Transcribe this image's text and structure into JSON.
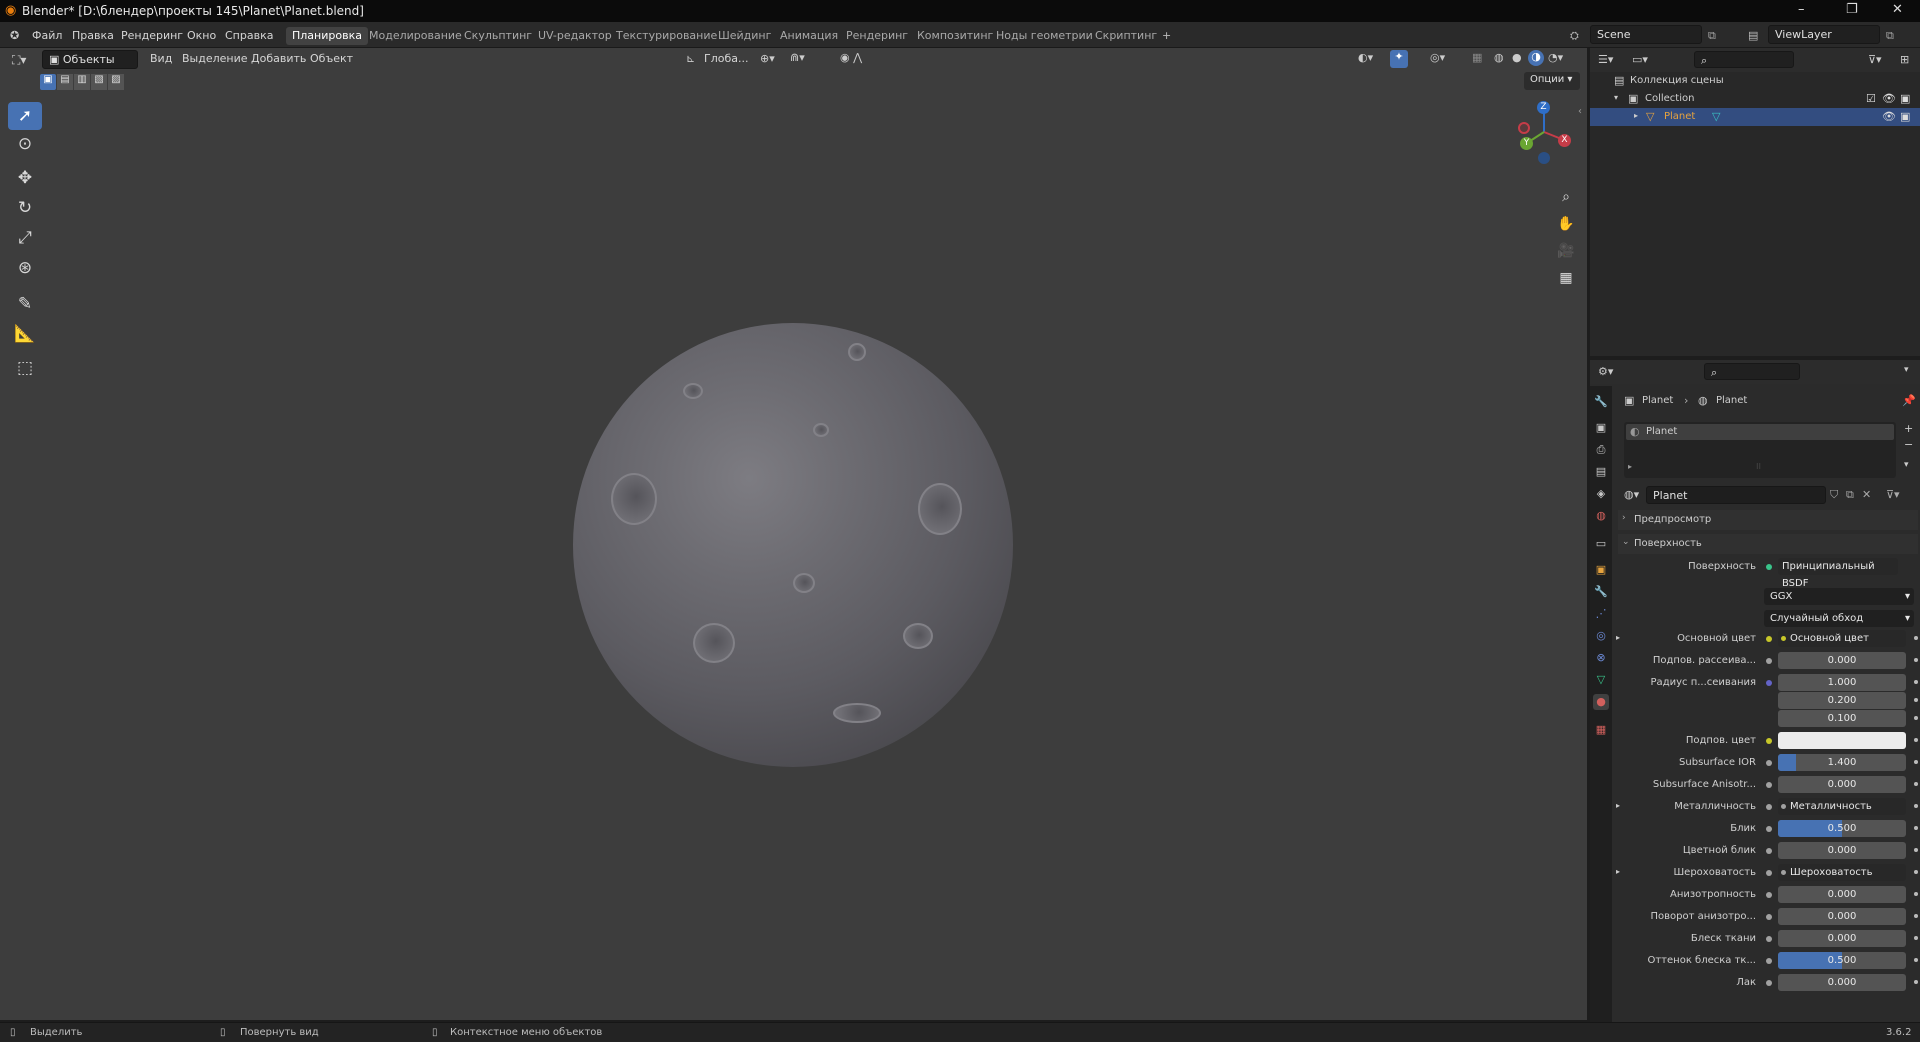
{
  "titlebar": {
    "title": "Blender* [D:\\блендер\\проекты 145\\Planet\\Planet.blend]",
    "minimize": "–",
    "maximize": "❐",
    "close": "✕"
  },
  "menu": {
    "items": [
      "Файл",
      "Правка",
      "Рендеринг",
      "Окно",
      "Справка"
    ]
  },
  "workspaces": {
    "tabs": [
      "Планировка",
      "Моделирование",
      "Скульптинг",
      "UV-редактор",
      "Текстурирование",
      "Шейдинг",
      "Анимация",
      "Рендеринг",
      "Композитинг",
      "Ноды геометрии",
      "Скриптинг"
    ],
    "active": "Планировка",
    "add": "+"
  },
  "scene": {
    "name": "Scene",
    "viewlayer": "ViewLayer"
  },
  "viewport_header": {
    "mode": "Объекты",
    "menus": [
      "Вид",
      "Выделение",
      "Добавить",
      "Объект"
    ],
    "orientation": "Глоба...",
    "options": "Опции"
  },
  "gizmo": {
    "z": "Z",
    "x": "X",
    "y": "Y"
  },
  "outliner": {
    "root": "Коллекция сцены",
    "collection": "Collection",
    "object": "Planet"
  },
  "properties": {
    "breadcrumb": [
      "Planet",
      "Planet"
    ],
    "slot": "Planet",
    "material": "Planet",
    "panel_preview": "Предпросмотр",
    "panel_surface": "Поверхность",
    "surface_label": "Поверхность",
    "surface_value": "Принципиальный BSDF",
    "distribution": "GGX",
    "subsurface_method": "Случайный обход",
    "rows": [
      {
        "label": "Основной цвет",
        "value": "Основной цвет",
        "type": "link"
      },
      {
        "label": "Подпов. рассеива...",
        "value": "0.000",
        "type": "num",
        "fill": 0
      },
      {
        "label": "Радиус п...сеивания",
        "value": "1.000",
        "type": "num",
        "fill": 0
      },
      {
        "label": "",
        "value": "0.200",
        "type": "num",
        "fill": 0
      },
      {
        "label": "",
        "value": "0.100",
        "type": "num",
        "fill": 0
      },
      {
        "label": "Подпов. цвет",
        "value": "",
        "type": "color"
      },
      {
        "label": "Subsurface IOR",
        "value": "1.400",
        "type": "num",
        "fill": 0.14
      },
      {
        "label": "Subsurface Anisotr...",
        "value": "0.000",
        "type": "num",
        "fill": 0
      },
      {
        "label": "Металличность",
        "value": "Металличность",
        "type": "link"
      },
      {
        "label": "Блик",
        "value": "0.500",
        "type": "num",
        "fill": 0.5
      },
      {
        "label": "Цветной блик",
        "value": "0.000",
        "type": "num",
        "fill": 0
      },
      {
        "label": "Шероховатость",
        "value": "Шероховатость",
        "type": "link"
      },
      {
        "label": "Анизотропность",
        "value": "0.000",
        "type": "num",
        "fill": 0
      },
      {
        "label": "Поворот анизотро...",
        "value": "0.000",
        "type": "num",
        "fill": 0
      },
      {
        "label": "Блеск ткани",
        "value": "0.000",
        "type": "num",
        "fill": 0
      },
      {
        "label": "Оттенок блеска тк...",
        "value": "0.500",
        "type": "num",
        "fill": 0.5
      },
      {
        "label": "Лак",
        "value": "0.000",
        "type": "num",
        "fill": 0
      }
    ]
  },
  "statusbar": {
    "select": "Выделить",
    "rotate": "Повернуть вид",
    "context": "Контекстное меню объектов",
    "version": "3.6.2"
  },
  "colors": {
    "accent": "#4772b3",
    "orange": "#e6a33e",
    "yellow_socket": "#c7c729",
    "purple_socket": "#6363c7",
    "gray_socket": "#a1a1a1"
  }
}
